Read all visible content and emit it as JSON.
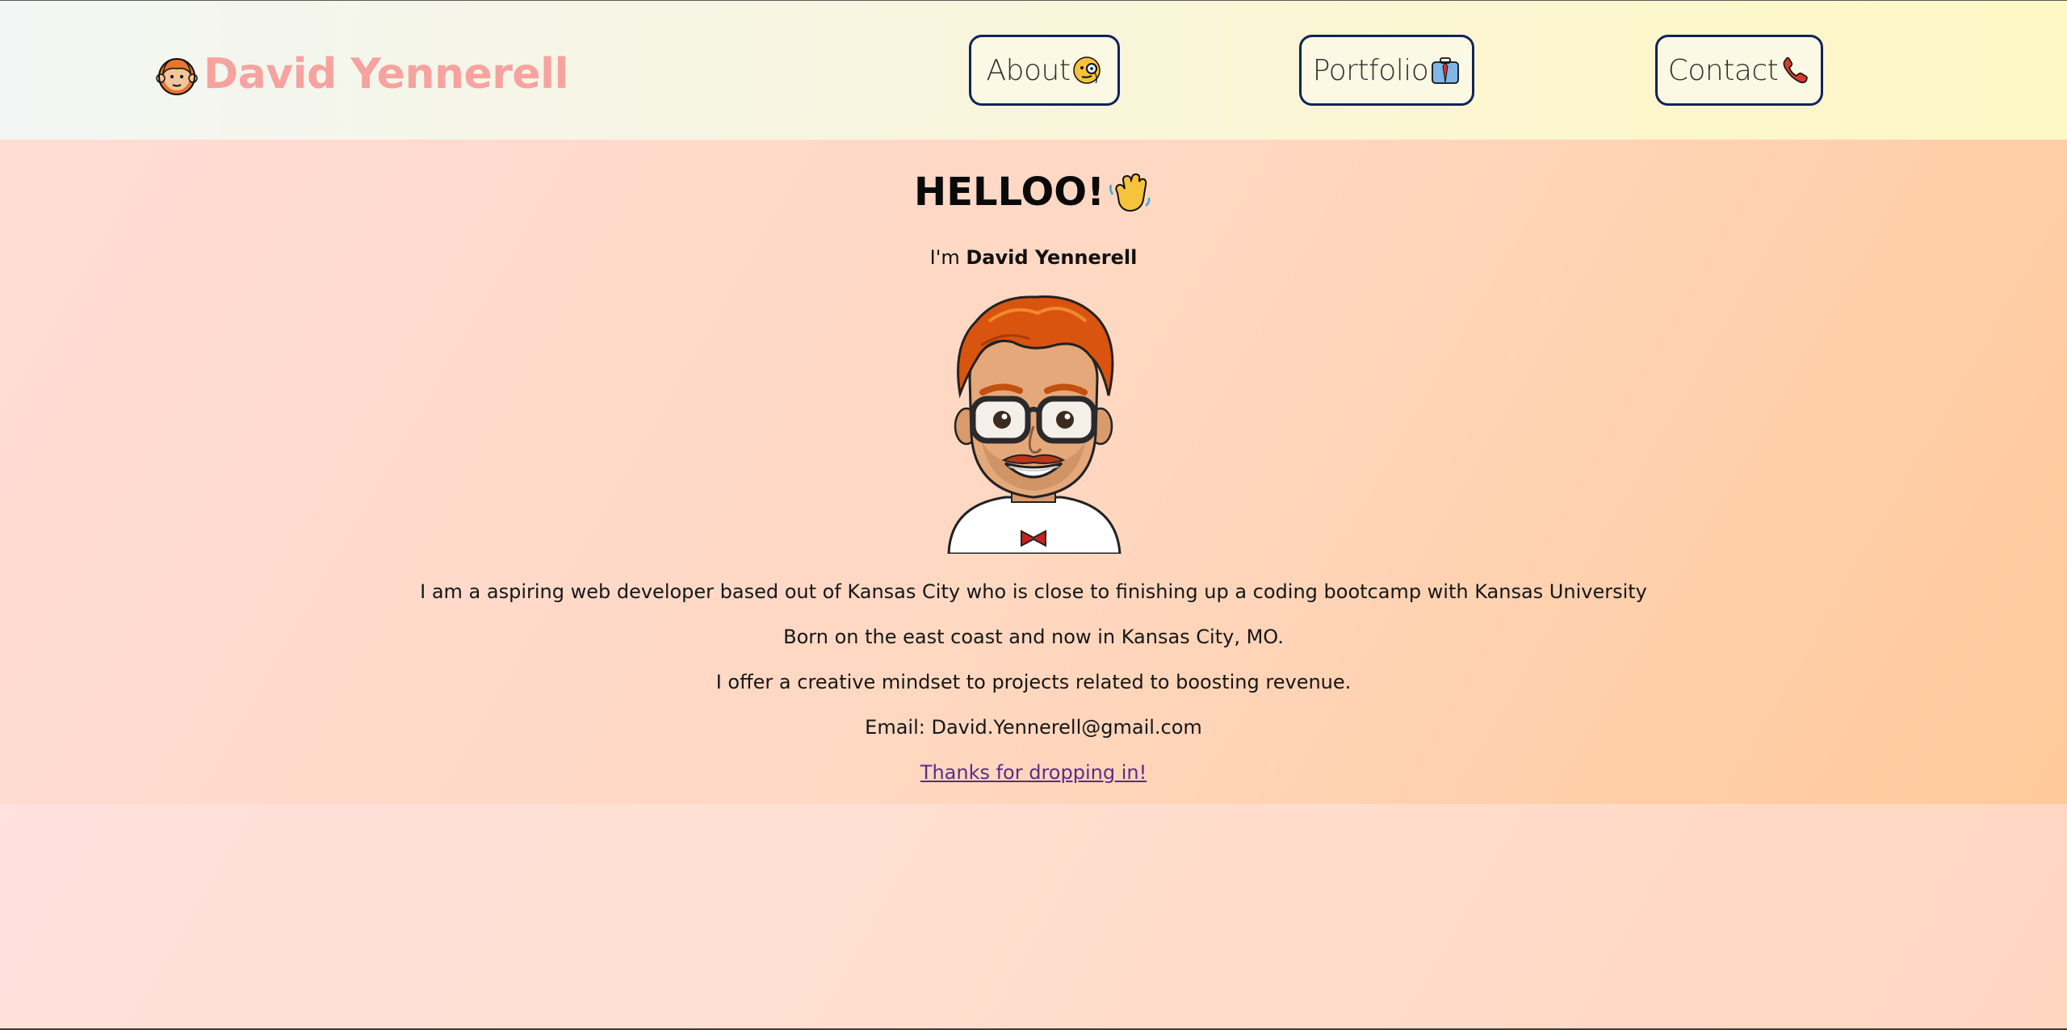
{
  "header": {
    "brand_name": "David Yennerell",
    "brand_icon": "red-haired-man-emoji",
    "nav": [
      {
        "label": "About",
        "icon": "monocle-face-emoji"
      },
      {
        "label": "Portfolio",
        "icon": "briefcase-emoji"
      },
      {
        "label": "Contact",
        "icon": "telephone-receiver-emoji"
      }
    ]
  },
  "main": {
    "greeting": "HELLOO!",
    "greeting_icon": "waving-hand-emoji",
    "intro_prefix": "I'm",
    "intro_name": "David Yennerell",
    "avatar": "cartoon-avatar-red-hair-glasses",
    "paragraphs": [
      "I am a aspiring web developer based out of Kansas City who is close to finishing up a coding bootcamp with Kansas University",
      "Born on the east coast and now in Kansas City, MO.",
      "I offer a creative mindset to projects related to boosting revenue.",
      "Email: David.Yennerell@gmail.com"
    ],
    "closing_link": "Thanks for dropping in!"
  },
  "colors": {
    "brand": "#f6a3a0",
    "nav_border": "#10235a",
    "link": "#5a2d86"
  }
}
